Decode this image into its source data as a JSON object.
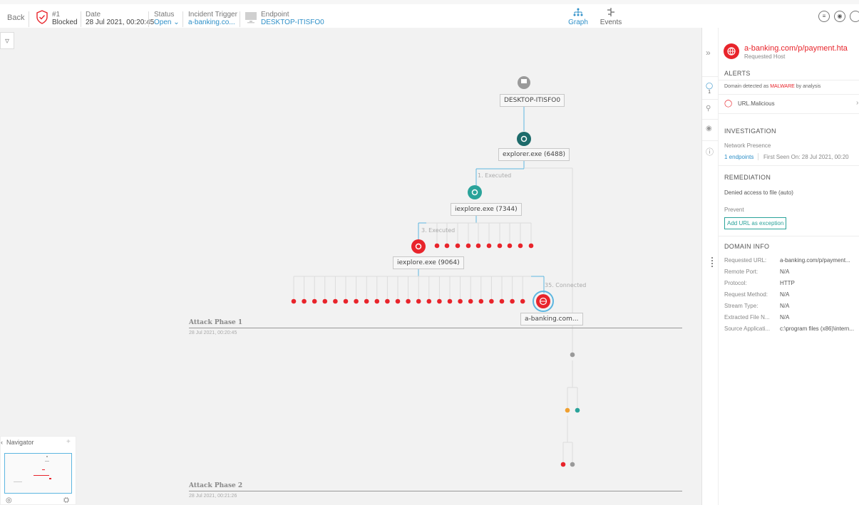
{
  "topbar": {
    "back_label": "Back",
    "incident_number": "#1",
    "incident_state": "Blocked",
    "date_label": "Date",
    "date_value": "28 Jul 2021, 00:20:45",
    "status_label": "Status",
    "status_value": "Open",
    "trigger_label": "Incident Trigger",
    "trigger_value": "a-banking.co...",
    "endpoint_label": "Endpoint",
    "endpoint_value": "DESKTOP-ITISFO0",
    "tab_graph": "Graph",
    "tab_events": "Events"
  },
  "graph": {
    "nodes": {
      "desktop": "DESKTOP-ITISFO0",
      "explorer": "explorer.exe (6488)",
      "iexplore1": "iexplore.exe (7344)",
      "iexplore2": "iexplore.exe (9064)",
      "host": "a-banking.com..."
    },
    "edges": {
      "executed1": "1. Executed",
      "executed3": "3. Executed",
      "connected": "35. Connected"
    },
    "phase1": {
      "title": "Attack Phase 1",
      "date": "28 Jul 2021, 00:20:45"
    },
    "phase2": {
      "title": "Attack Phase 2",
      "date": "28 Jul 2021, 00:21:26"
    },
    "colors": {
      "malicious": "#e8242b",
      "teal": "#2aa39a",
      "dark_teal": "#1d6b6b",
      "grey": "#9a9a9a",
      "orange": "#f0a030",
      "edge": "#5db6e0"
    }
  },
  "navigator": {
    "title": "Navigator"
  },
  "panel": {
    "title": "a-banking.com/p/payment.hta",
    "subtitle": "Requested Host",
    "alerts_header": "ALERTS",
    "alert_text_pre": "Domain detected as ",
    "alert_text_hl": "MALWARE",
    "alert_text_post": " by analysis",
    "alert_item": "URL.Malicious",
    "rail_count": "1",
    "investigation_header": "INVESTIGATION",
    "network_presence": "Network Presence",
    "endpoints_link": "1 endpoints",
    "first_seen": "First Seen On:  28 Jul 2021, 00:20",
    "remediation_header": "REMEDIATION",
    "remediation_text": "Denied access to file (auto)",
    "prevent_label": "Prevent",
    "add_exception_button": "Add URL as exception",
    "domain_info_header": "DOMAIN INFO",
    "domain_info": [
      {
        "label": "Requested URL:",
        "value": "a-banking.com/p/payment..."
      },
      {
        "label": "Remote Port:",
        "value": "N/A"
      },
      {
        "label": "Protocol:",
        "value": "HTTP"
      },
      {
        "label": "Request Method:",
        "value": "N/A"
      },
      {
        "label": "Stream Type:",
        "value": "N/A"
      },
      {
        "label": "Extracted File N...",
        "value": "N/A"
      },
      {
        "label": "Source Applicati...",
        "value": "c:\\program files (x86)\\intern..."
      }
    ]
  }
}
